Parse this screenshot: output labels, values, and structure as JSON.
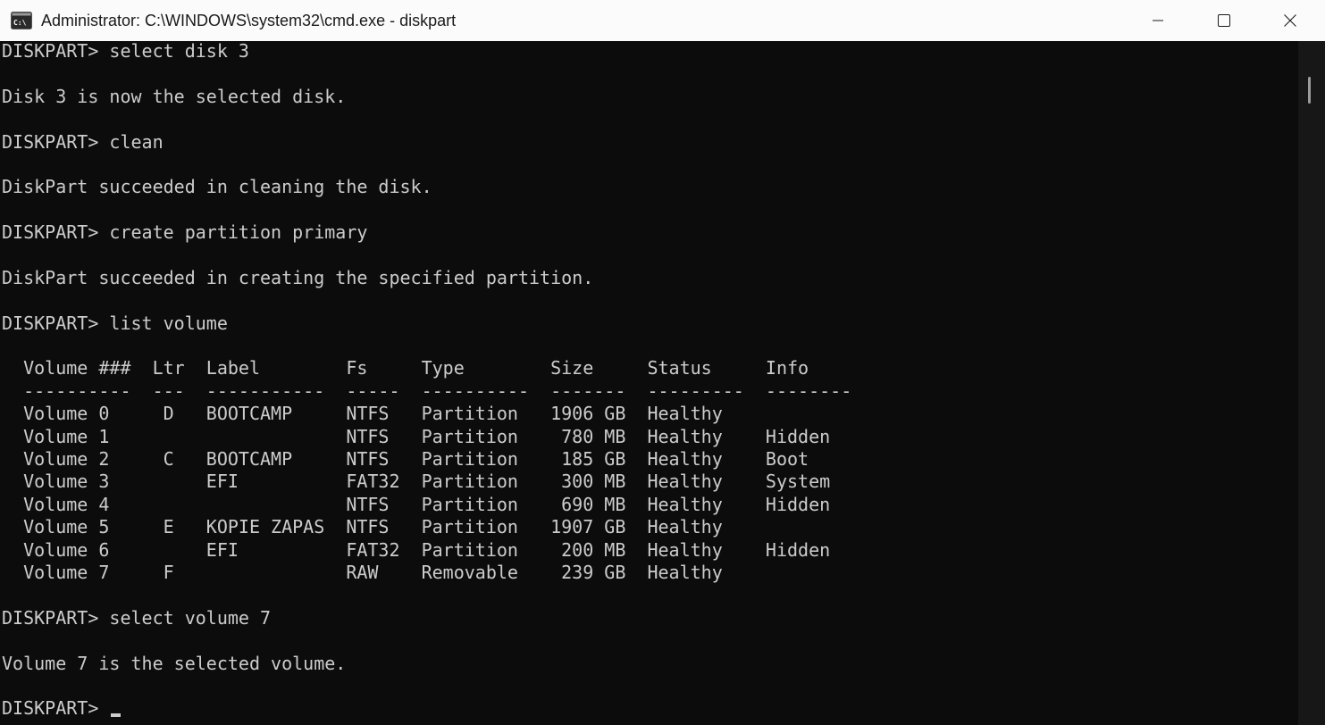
{
  "window": {
    "title": "Administrator: C:\\WINDOWS\\system32\\cmd.exe - diskpart",
    "icon": "cmd-icon",
    "controls": {
      "minimize_icon": "minimize-icon",
      "maximize_icon": "maximize-icon",
      "close_icon": "close-icon"
    }
  },
  "console": {
    "lines": [
      "DISKPART> select disk 3",
      "",
      "Disk 3 is now the selected disk.",
      "",
      "DISKPART> clean",
      "",
      "DiskPart succeeded in cleaning the disk.",
      "",
      "DISKPART> create partition primary",
      "",
      "DiskPart succeeded in creating the specified partition.",
      "",
      "DISKPART> list volume",
      "",
      "  Volume ###  Ltr  Label        Fs     Type        Size     Status     Info",
      "  ----------  ---  -----------  -----  ----------  -------  ---------  --------",
      "  Volume 0     D   BOOTCAMP     NTFS   Partition   1906 GB  Healthy",
      "  Volume 1                      NTFS   Partition    780 MB  Healthy    Hidden",
      "  Volume 2     C   BOOTCAMP     NTFS   Partition    185 GB  Healthy    Boot",
      "  Volume 3         EFI          FAT32  Partition    300 MB  Healthy    System",
      "  Volume 4                      NTFS   Partition    690 MB  Healthy    Hidden",
      "  Volume 5     E   KOPIE ZAPAS  NTFS   Partition   1907 GB  Healthy",
      "  Volume 6         EFI          FAT32  Partition    200 MB  Healthy    Hidden",
      "  Volume 7     F                RAW    Removable    239 GB  Healthy",
      "",
      "DISKPART> select volume 7",
      "",
      "Volume 7 is the selected volume.",
      "",
      "DISKPART> "
    ],
    "text_color": "#cccccc",
    "background_color": "#0c0c0c"
  }
}
